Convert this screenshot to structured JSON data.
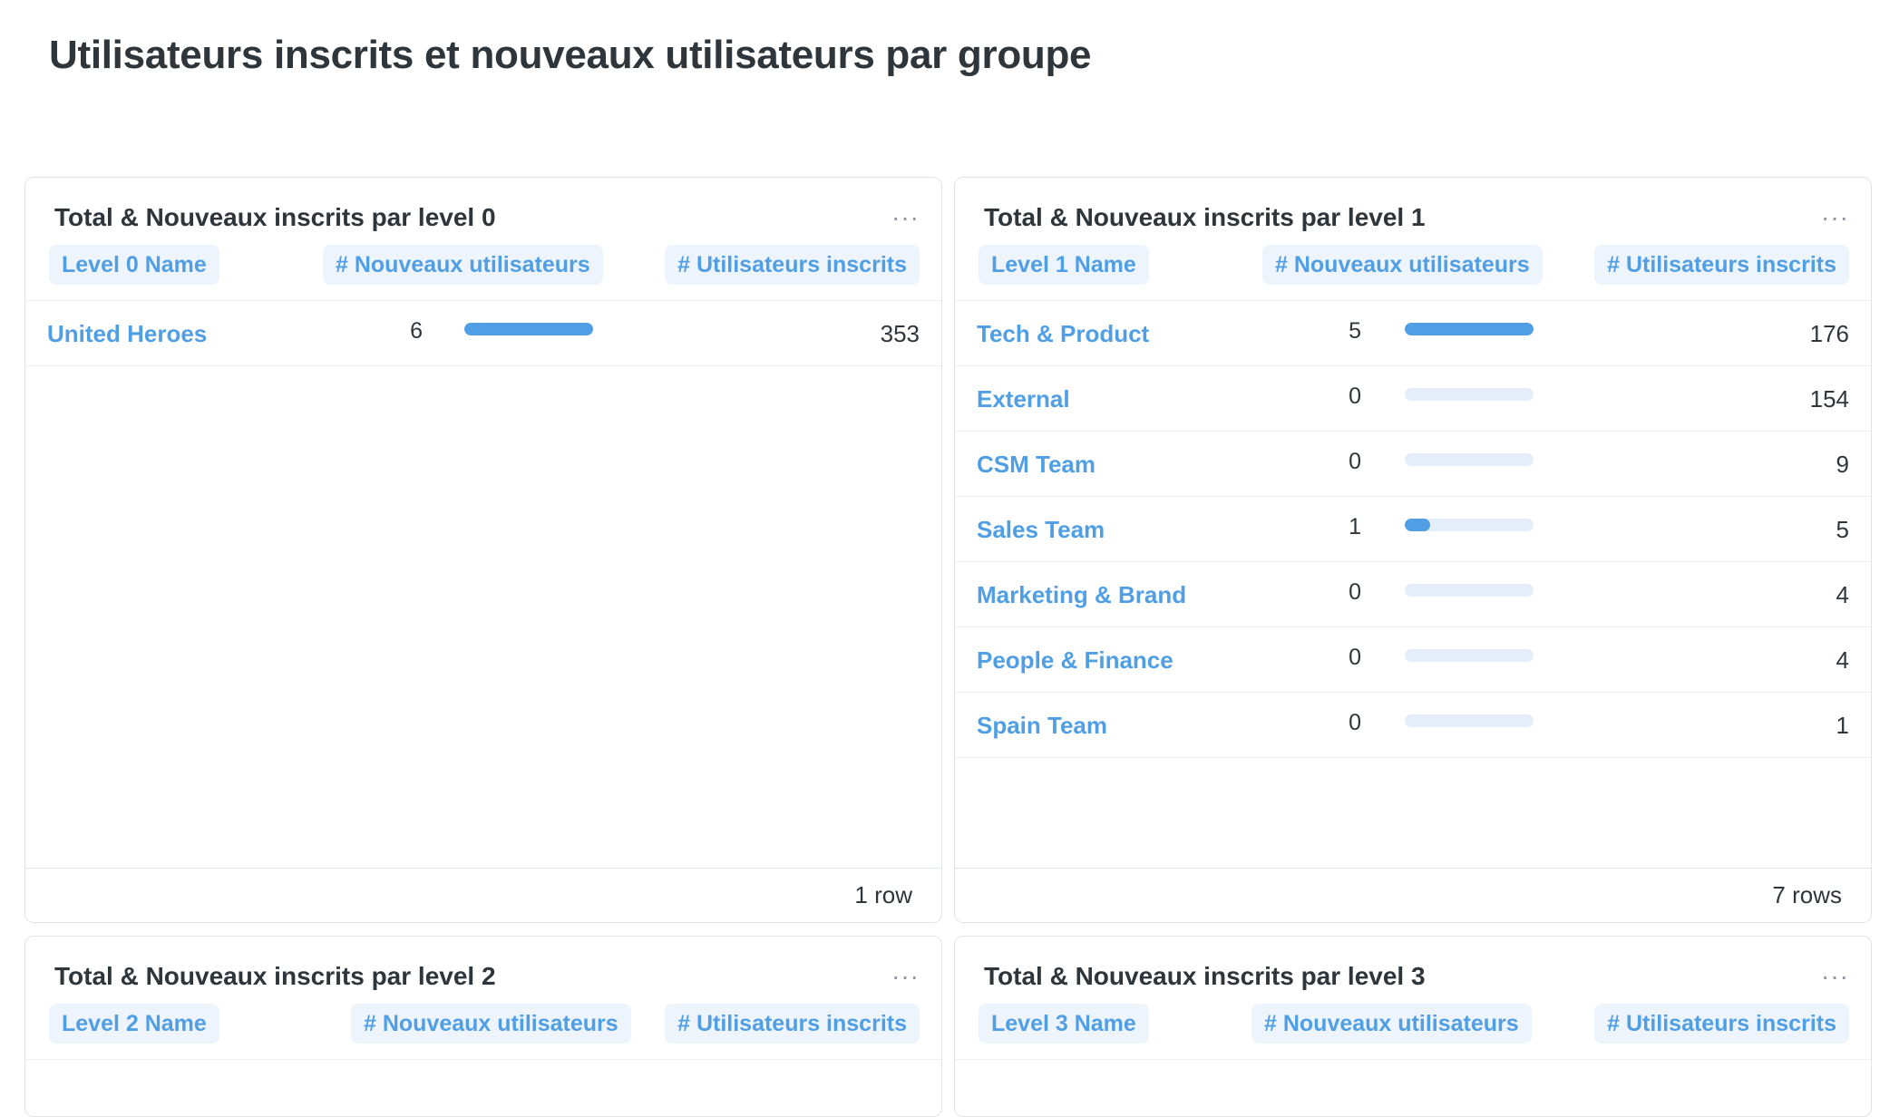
{
  "dashboard": {
    "title": "Utilisateurs inscrits et nouveaux utilisateurs par groupe"
  },
  "colors": {
    "accent": "#509ee3",
    "pill_bg": "#eef4fb",
    "bar_track": "#e3eefa",
    "text": "#2e353b"
  },
  "icons": {
    "menu": "more-horizontal-icon"
  },
  "cards": [
    {
      "title": "Total & Nouveaux inscrits par level 0",
      "menu_glyph": "···",
      "col_name": "Level 0 Name",
      "col_new": "# Nouveaux utilisateurs",
      "col_total": "# Utilisateurs inscrits",
      "max_new": 6,
      "rows": [
        {
          "name": "United Heroes",
          "new": 6,
          "total": 353
        }
      ],
      "footer": "1 row"
    },
    {
      "title": "Total & Nouveaux inscrits par level 1",
      "menu_glyph": "···",
      "col_name": "Level 1 Name",
      "col_new": "# Nouveaux utilisateurs",
      "col_total": "# Utilisateurs inscrits",
      "max_new": 5,
      "rows": [
        {
          "name": "Tech & Product",
          "new": 5,
          "total": 176
        },
        {
          "name": "External",
          "new": 0,
          "total": 154
        },
        {
          "name": "CSM Team",
          "new": 0,
          "total": 9
        },
        {
          "name": "Sales Team",
          "new": 1,
          "total": 5
        },
        {
          "name": "Marketing & Brand",
          "new": 0,
          "total": 4
        },
        {
          "name": "People & Finance",
          "new": 0,
          "total": 4
        },
        {
          "name": "Spain Team",
          "new": 0,
          "total": 1
        }
      ],
      "footer": "7 rows"
    },
    {
      "title": "Total & Nouveaux inscrits par level 2",
      "menu_glyph": "···",
      "col_name": "Level 2 Name",
      "col_new": "# Nouveaux utilisateurs",
      "col_total": "# Utilisateurs inscrits",
      "rows": []
    },
    {
      "title": "Total & Nouveaux inscrits par level 3",
      "menu_glyph": "···",
      "col_name": "Level 3 Name",
      "col_new": "# Nouveaux utilisateurs",
      "col_total": "# Utilisateurs inscrits",
      "rows": []
    }
  ]
}
